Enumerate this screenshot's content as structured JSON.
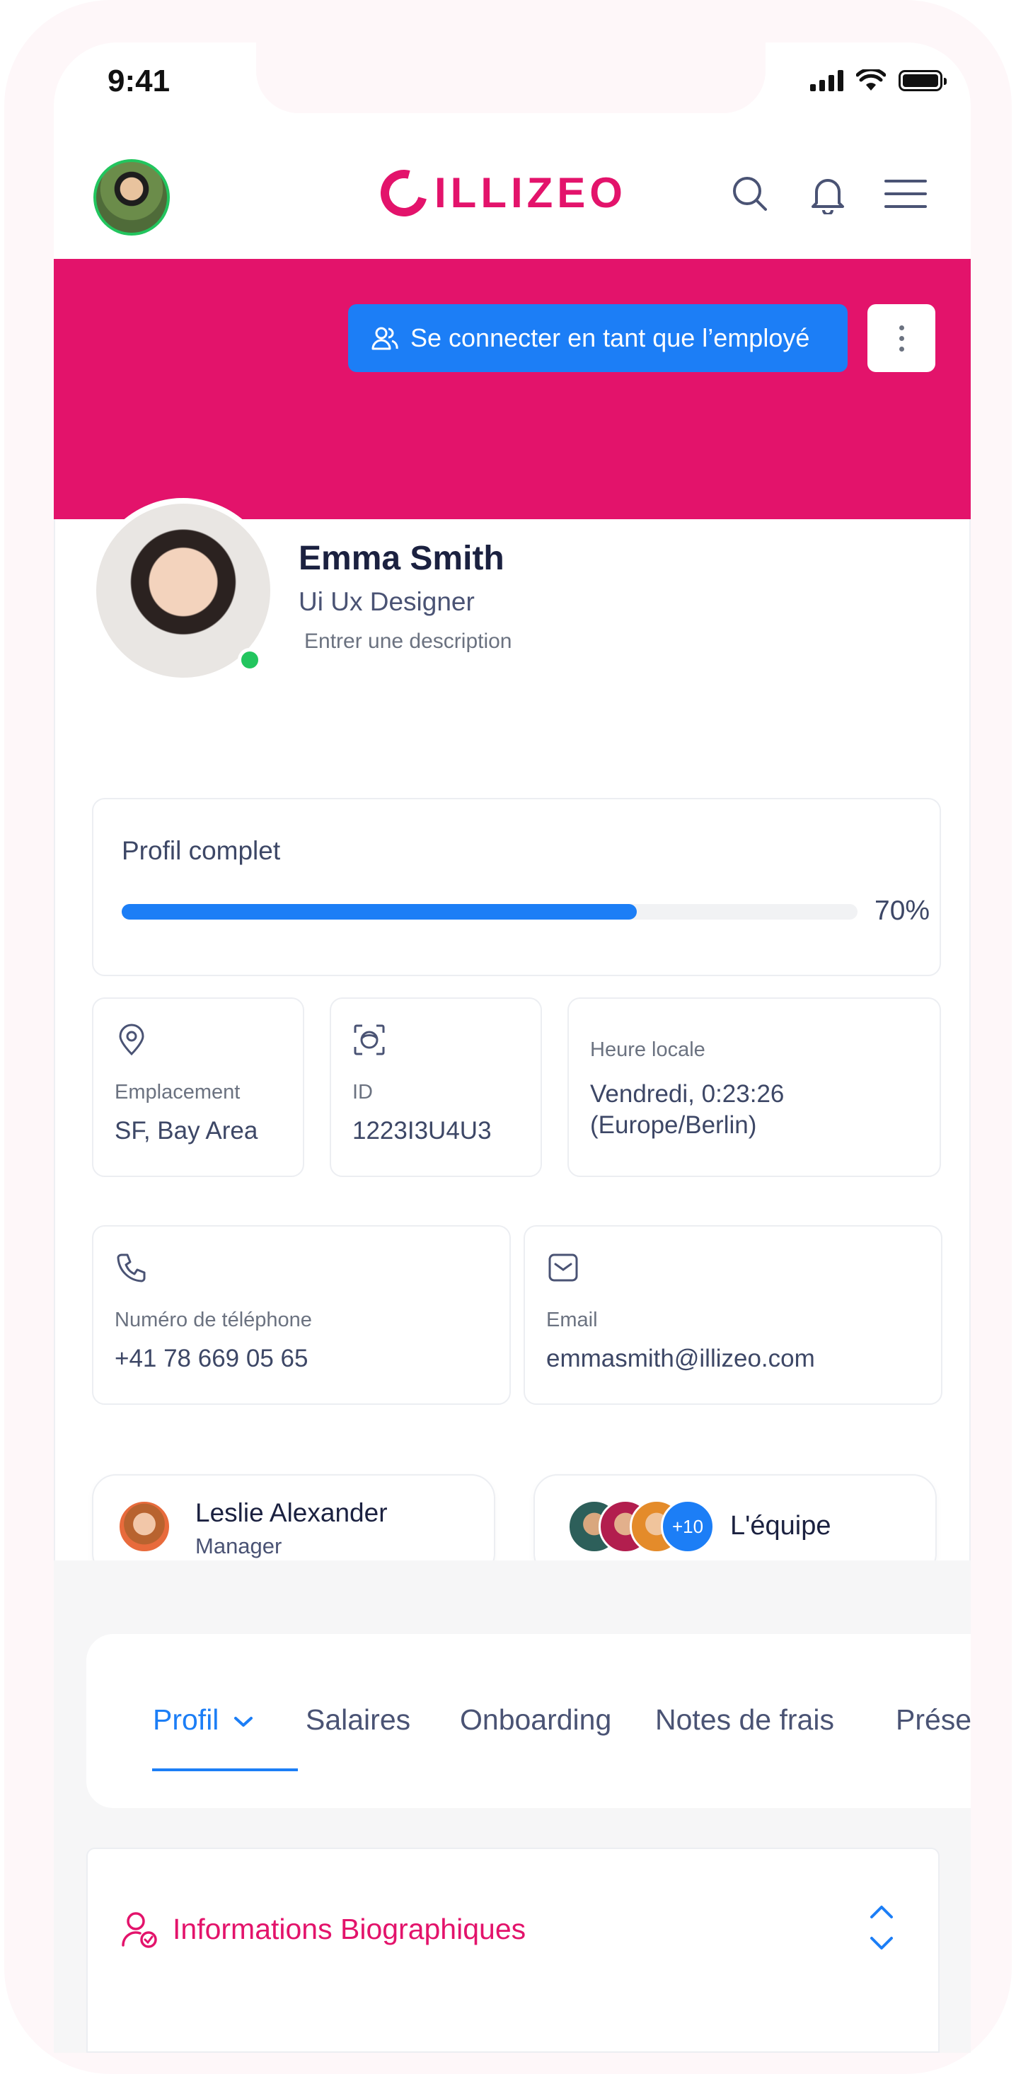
{
  "status_bar": {
    "time": "9:41"
  },
  "header": {
    "logo_text": "ILLIZEO",
    "brand_color": "#e3136b"
  },
  "banner": {
    "impersonate_label": "Se connecter en tant que l’employé",
    "color": "#e3136b",
    "button_color": "#1c7ef6"
  },
  "profile": {
    "name": "Emma Smith",
    "role": "Ui Ux Designer",
    "description_placeholder": "Entrer une description",
    "online_status_color": "#22c55e"
  },
  "completion": {
    "title": "Profil complet",
    "percent_label": "70%",
    "value": 0.7
  },
  "info": {
    "location": {
      "icon": "map-pin-icon",
      "label": "Emplacement",
      "value": "SF, Bay Area"
    },
    "id": {
      "icon": "face-id-icon",
      "label": "ID",
      "value": "1223I3U4U3"
    },
    "local_time": {
      "label": "Heure locale",
      "value_line1": "Vendredi, 0:23:26",
      "value_line2": "(Europe/Berlin)"
    },
    "phone": {
      "icon": "phone-icon",
      "label": "Numéro de téléphone",
      "value": "+41 78 669 05 65"
    },
    "email": {
      "icon": "mail-icon",
      "label": "Email",
      "value": "emmasmith@illizeo.com"
    }
  },
  "manager": {
    "name": "Leslie Alexander",
    "title": "Manager"
  },
  "team": {
    "label": "L'équipe",
    "extra_count": "+10"
  },
  "tabs": [
    {
      "label": "Profil",
      "active": true
    },
    {
      "label": "Salaires",
      "active": false
    },
    {
      "label": "Onboarding",
      "active": false
    },
    {
      "label": "Notes de frais",
      "active": false
    },
    {
      "label": "Prése",
      "active": false
    }
  ],
  "section": {
    "title": "Informations Biographiques"
  }
}
